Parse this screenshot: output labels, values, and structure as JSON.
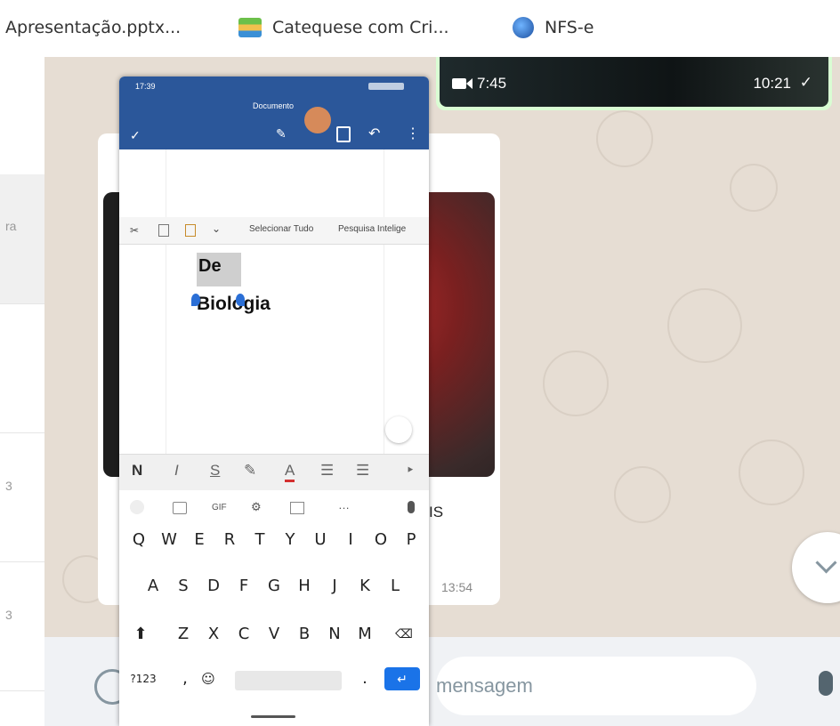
{
  "bookmarks": [
    {
      "label": "Apresentação.pptx...",
      "icon": "document-icon"
    },
    {
      "label": "Catequese com Cri...",
      "icon": "site-thumbnail-icon"
    },
    {
      "label": "NFS-e",
      "icon": "globe-icon"
    }
  ],
  "left_list": {
    "row1_snippet": "ra",
    "row2_snippet": "3",
    "row3_snippet": "3"
  },
  "video_message": {
    "duration": "7:45",
    "time": "10:21",
    "status": "✓"
  },
  "image_message": {
    "time": "13:54",
    "caption_fragment": "IS"
  },
  "phone": {
    "status_time": "17:39",
    "doc_title": "Documento",
    "ribbon": {
      "select_all": "Selecionar Tudo",
      "smart_search": "Pesquisa Intelige"
    },
    "doc_lines": [
      "De",
      "Biologia"
    ],
    "format": {
      "bold": "N",
      "italic": "I",
      "strike": "S"
    },
    "kb_top": {
      "gif": "GIF"
    },
    "rows": [
      [
        "Q",
        "W",
        "E",
        "R",
        "T",
        "Y",
        "U",
        "I",
        "O",
        "P"
      ],
      [
        "A",
        "S",
        "D",
        "F",
        "G",
        "H",
        "J",
        "K",
        "L"
      ],
      [
        "Z",
        "X",
        "C",
        "V",
        "B",
        "N",
        "M"
      ]
    ],
    "numbers_key": "?123",
    "comma_key": ",",
    "period_key": "."
  },
  "composer": {
    "placeholder": "mensagem"
  },
  "colors": {
    "word_blue": "#2b579a",
    "wa_bg": "#efeae2",
    "bubble_green": "#d9fdd3",
    "enter_blue": "#1a73e8"
  }
}
